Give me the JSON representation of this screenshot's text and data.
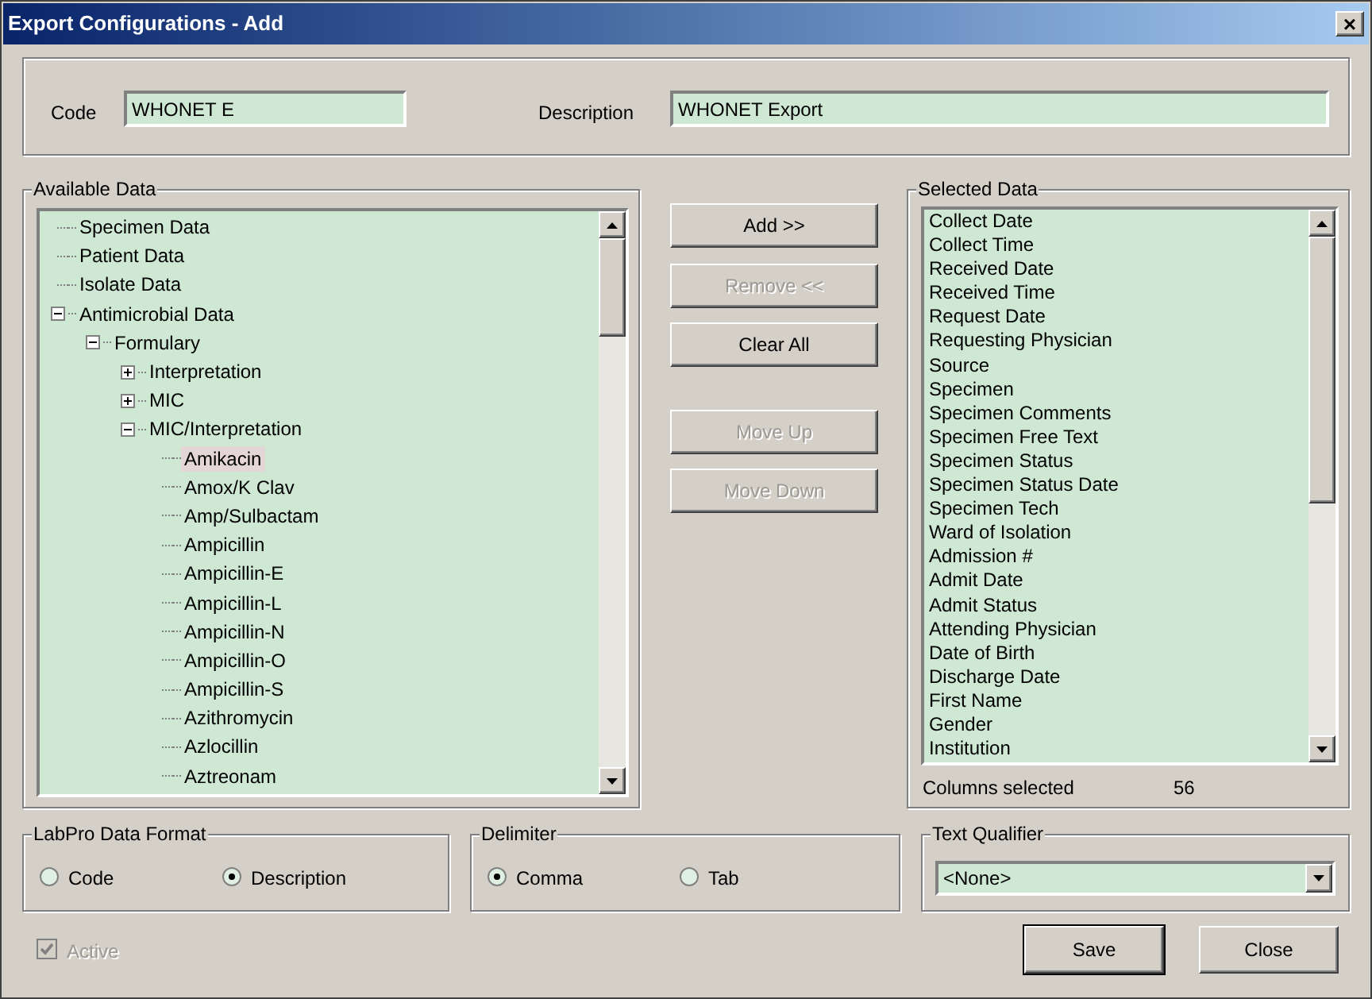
{
  "window": {
    "title": "Export Configurations - Add",
    "close": "×"
  },
  "code": {
    "label": "Code",
    "value": "WHONET E"
  },
  "description": {
    "label": "Description",
    "value": "WHONET Export"
  },
  "available": {
    "title": "Available Data",
    "tree": [
      {
        "label": "Specimen Data",
        "selected": false
      },
      {
        "label": "Patient Data",
        "selected": false
      },
      {
        "label": "Isolate Data",
        "selected": false
      },
      {
        "label": "Antimicrobial Data",
        "selected": false,
        "expanded": true,
        "children": [
          {
            "label": "Formulary",
            "selected": false,
            "expanded": true,
            "children": [
              {
                "label": "Interpretation",
                "selected": false,
                "expanded": false
              },
              {
                "label": "MIC",
                "selected": false,
                "expanded": false
              },
              {
                "label": "MIC/Interpretation",
                "selected": false,
                "expanded": true,
                "children": [
                  {
                    "label": "Amikacin",
                    "selected": true
                  },
                  {
                    "label": "Amox/K Clav",
                    "selected": false
                  },
                  {
                    "label": "Amp/Sulbactam",
                    "selected": false
                  },
                  {
                    "label": "Ampicillin",
                    "selected": false
                  },
                  {
                    "label": "Ampicillin-E",
                    "selected": false
                  },
                  {
                    "label": "Ampicillin-L",
                    "selected": false
                  },
                  {
                    "label": "Ampicillin-N",
                    "selected": false
                  },
                  {
                    "label": "Ampicillin-O",
                    "selected": false
                  },
                  {
                    "label": "Ampicillin-S",
                    "selected": false
                  },
                  {
                    "label": "Azithromycin",
                    "selected": false
                  },
                  {
                    "label": "Azlocillin",
                    "selected": false
                  },
                  {
                    "label": "Aztreonam",
                    "selected": false
                  }
                ]
              }
            ]
          }
        ]
      }
    ]
  },
  "buttons": [
    {
      "label": "Add >>",
      "disabled": false
    },
    {
      "label": "Remove <<",
      "disabled": true
    },
    {
      "label": "Clear All",
      "disabled": false
    },
    {
      "label": "Move Up",
      "disabled": true
    },
    {
      "label": "Move Down",
      "disabled": true
    }
  ],
  "selected_data": {
    "title": "Selected Data",
    "items": [
      "Collect Date",
      "Collect Time",
      "Received Date",
      "Received Time",
      "Request Date",
      "Requesting Physician",
      "Source",
      "Specimen",
      "Specimen Comments",
      "Specimen Free Text",
      "Specimen Status",
      "Specimen Status Date",
      "Specimen Tech",
      "Ward of Isolation",
      "Admission #",
      "Admit Date",
      "Admit Status",
      "Attending Physician",
      "Date of Birth",
      "Discharge Date",
      "First Name",
      "Gender",
      "Institution"
    ],
    "count_label": "Columns selected",
    "count": "56"
  },
  "format": {
    "title": "LabPro Data Format",
    "options": [
      {
        "label": "Code",
        "selected": false
      },
      {
        "label": "Description",
        "selected": true
      }
    ]
  },
  "delimiter": {
    "title": "Delimiter",
    "options": [
      {
        "label": "Comma",
        "selected": true
      },
      {
        "label": "Tab",
        "selected": false
      }
    ]
  },
  "text_qualifier": {
    "title": "Text Qualifier",
    "value": "<None>"
  },
  "active": {
    "label": "Active",
    "checked": true,
    "disabled": true
  },
  "actions": [
    {
      "label": "Save",
      "default": true
    },
    {
      "label": "Close",
      "default": false
    }
  ]
}
